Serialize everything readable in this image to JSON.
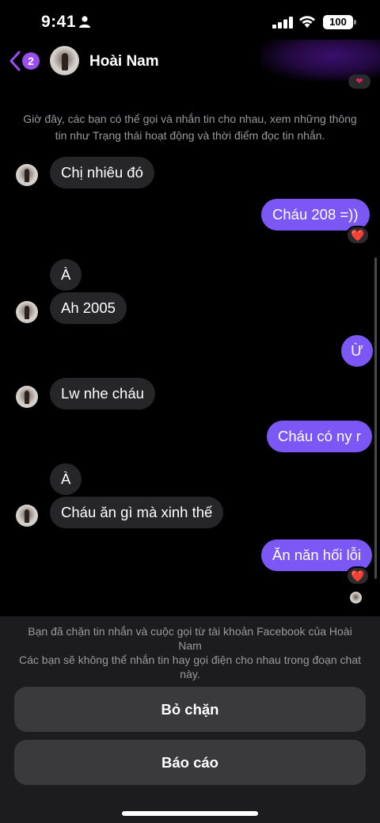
{
  "status_bar": {
    "time": "9:41",
    "battery": "100"
  },
  "header": {
    "back_badge": "2",
    "contact_name": "Hoài Nam"
  },
  "system_note": "Giờ đây, các bạn có thể gọi và nhắn tin cho nhau, xem những thông tin như Trạng thái hoạt động và thời điểm đọc tin nhắn.",
  "messages": [
    {
      "side": "in",
      "text": "Chị nhiêu đó"
    },
    {
      "side": "out",
      "text": "Cháu 208 =))",
      "reaction": "❤️"
    },
    {
      "side": "in",
      "text": "À"
    },
    {
      "side": "in",
      "text": "Ah 2005"
    },
    {
      "side": "out",
      "text": "Ừ"
    },
    {
      "side": "in",
      "text": "Lw nhe cháu"
    },
    {
      "side": "out",
      "text": "Cháu có ny r"
    },
    {
      "side": "in",
      "text": "À"
    },
    {
      "side": "in",
      "text": "Cháu ăn gì mà xinh thế"
    },
    {
      "side": "out",
      "text": "Ăn năn hối lỗi",
      "reaction": "❤️"
    }
  ],
  "block_notice": {
    "line1": "Bạn đã chặn tin nhắn và cuộc gọi từ tài khoản Facebook của Hoài Nam",
    "line2": "Các bạn sẽ không thể nhắn tin hay gọi điện cho nhau trong đoạn chat này."
  },
  "buttons": {
    "unblock": "Bỏ chặn",
    "report": "Báo cáo"
  },
  "colors": {
    "outgoing_bubble": "#7b57f5",
    "incoming_bubble": "#262629",
    "accent": "#9b4ef0",
    "heart": "#ff2d55"
  }
}
